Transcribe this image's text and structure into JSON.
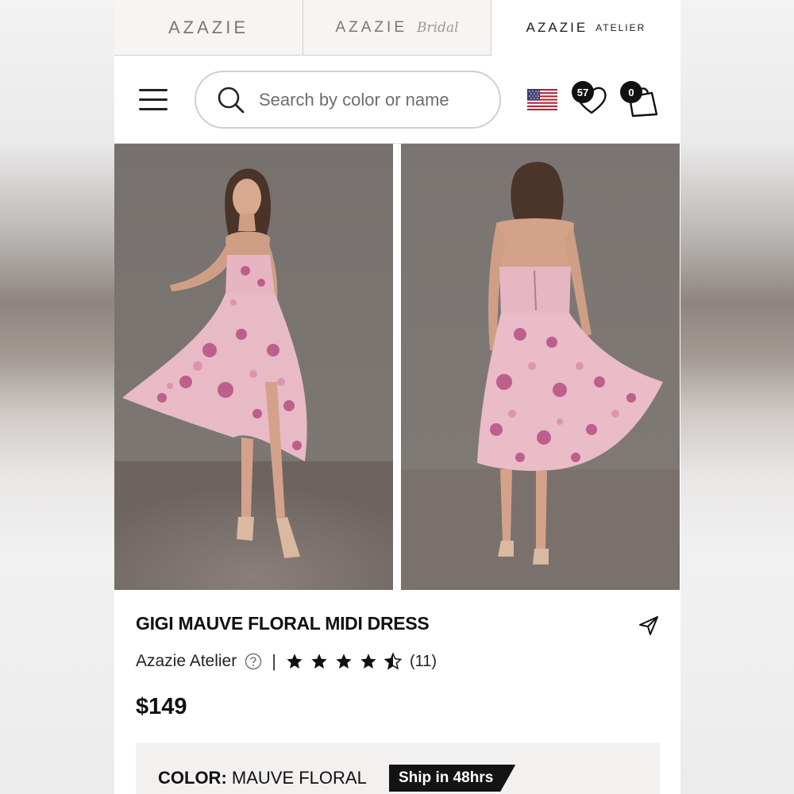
{
  "brands": {
    "azazie": "AZAZIE",
    "bridal_main": "AZAZIE",
    "bridal_script": "Bridal",
    "atelier_main": "AZAZIE",
    "atelier_sub": "ATELIER"
  },
  "header": {
    "search_placeholder": "Search by color or name",
    "wishlist_count": "57",
    "cart_count": "0"
  },
  "product": {
    "title": "GIGI MAUVE FLORAL MIDI DRESS",
    "brand": "Azazie Atelier",
    "separator": "|",
    "rating": 4.5,
    "review_count": "(11)",
    "price": "$149",
    "color_label": "COLOR:",
    "color_value": "MAUVE FLORAL",
    "ship_tag": "Ship in 48hrs"
  },
  "colors": {
    "accent": "#141414",
    "dress_pink": "#e7b8c4",
    "floral_magenta": "#b0407a",
    "backdrop": "#7d7774"
  },
  "icons": [
    "hamburger-icon",
    "search-icon",
    "us-flag-icon",
    "heart-icon",
    "shopping-bag-icon",
    "share-icon",
    "help-icon",
    "star-icon"
  ]
}
